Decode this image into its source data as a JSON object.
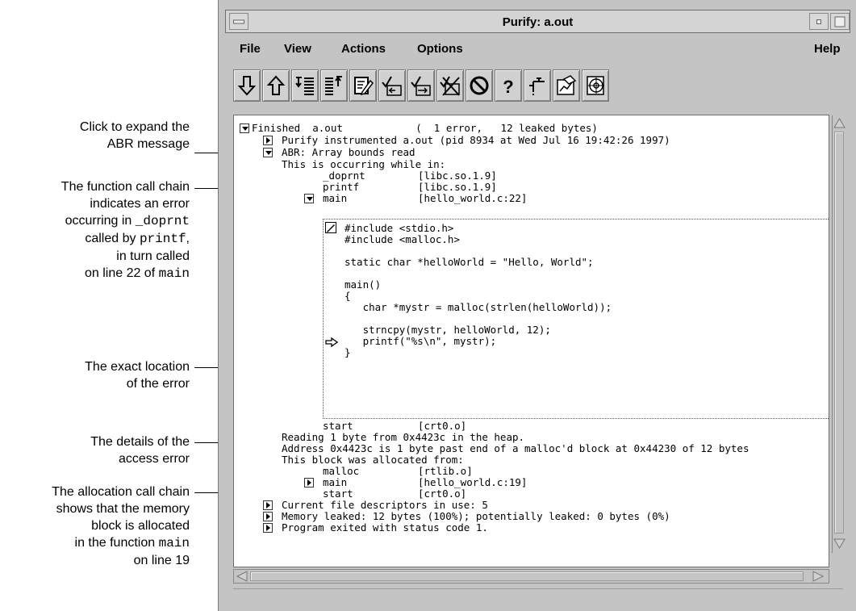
{
  "window": {
    "title": "Purify: a.out"
  },
  "menubar": {
    "file": "File",
    "view": "View",
    "actions": "Actions",
    "options": "Options",
    "help": "Help"
  },
  "toolbar": {
    "buttons": [
      "next-message-icon",
      "previous-message-icon",
      "expand-icon",
      "collapse-icon",
      "edit-icon",
      "suppress-icon",
      "unsuppress-icon",
      "kill-icon",
      "no-icon",
      "help-question-icon",
      "faucet-icon",
      "coverage-icon",
      "target-icon"
    ],
    "help_glyph": "?"
  },
  "annotations": {
    "expand_abr": [
      "Click to expand the",
      "ABR message"
    ],
    "call_chain": [
      "The function call chain",
      "indicates an error",
      "occurring in ",
      "called by ",
      ",",
      "in turn called",
      "on line 22 of "
    ],
    "call_chain_code": [
      "_doprnt",
      "printf",
      "main"
    ],
    "exact_location": [
      "The exact location",
      "of the error"
    ],
    "details": [
      "The details of the",
      "access error"
    ],
    "alloc_chain": [
      "The allocation call chain",
      "shows that the memory",
      "block is allocated",
      "in the function ",
      "on line 19"
    ],
    "alloc_chain_code": "main"
  },
  "output": {
    "finished": "Finished  a.out            (  1 error,   12 leaked bytes)",
    "instrumented": "Purify instrumented a.out (pid 8934 at Wed Jul 16 19:42:26 1997)",
    "abr": "ABR: Array bounds read",
    "occurring": "This is occurring while in:",
    "chain": [
      {
        "fn": "_doprnt",
        "loc": "[libc.so.1.9]"
      },
      {
        "fn": "printf",
        "loc": "[libc.so.1.9]"
      },
      {
        "fn": "main",
        "loc": "[hello_world.c:22]"
      }
    ],
    "source": [
      "#include <stdio.h>",
      "#include <malloc.h>",
      "",
      "static char *helloWorld = \"Hello, World\";",
      "",
      "main()",
      "{",
      "   char *mystr = malloc(strlen(helloWorld));",
      "",
      "   strncpy(mystr, helloWorld, 12);",
      "   printf(\"%s\\n\", mystr);",
      "}"
    ],
    "start_line": {
      "fn": "start",
      "loc": "[crt0.o]"
    },
    "reading": "Reading 1 byte from 0x4423c in the heap.",
    "address": "Address 0x4423c is 1 byte past end of a malloc'd block at 0x44230 of 12 bytes",
    "allocated": "This block was allocated from:",
    "alloc_chain": [
      {
        "fn": "malloc",
        "loc": "[rtlib.o]"
      },
      {
        "fn": "main",
        "loc": "[hello_world.c:19]"
      },
      {
        "fn": "start",
        "loc": "[crt0.o]"
      }
    ],
    "descriptors": "Current file descriptors in use: 5",
    "leaked": "Memory leaked: 12 bytes (100%); potentially leaked: 0 bytes (0%)",
    "exited": "Program exited with status code 1."
  }
}
